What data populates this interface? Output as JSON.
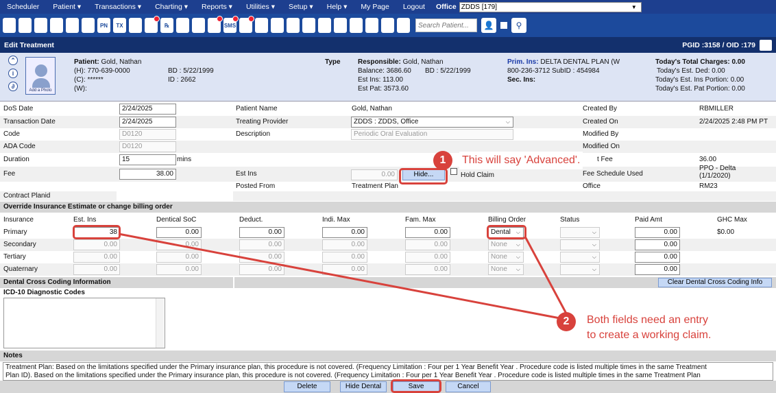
{
  "menu": {
    "items": [
      "Scheduler",
      "Patient ▾",
      "Transactions ▾",
      "Charting ▾",
      "Reports ▾",
      "Utilities ▾",
      "Setup ▾",
      "Help ▾",
      "My Page",
      "Logout"
    ],
    "office_label": "Office",
    "office_value": "ZDDS [179]"
  },
  "toolbar": {
    "icons": [
      "home-icon",
      "calendar-icon",
      "network-icon",
      "pen-icon",
      "tooth-icon",
      "tooth-chart-icon",
      "pn-icon",
      "tx-icon",
      "add-person-icon",
      "globe-icon",
      "rx-icon",
      "message-icon",
      "chat-icon",
      "list-icon",
      "sms-icon",
      "refresh-icon",
      "dollar-icon",
      "org-icon",
      "chart-icon",
      "support-icon",
      "megaphone-icon",
      "print-icon",
      "document-icon",
      "shield-check-icon",
      "shield-plus-icon",
      "chevron-down-badge-icon"
    ],
    "badges": [
      9,
      13,
      14,
      15
    ],
    "labels": {
      "pn": "PN",
      "tx": "TX",
      "rx": "℞",
      "sms": "SMS"
    },
    "search_placeholder": "Search Patient..."
  },
  "title": {
    "left": "Edit Treatment",
    "right": "PGID :3158 / OID :179"
  },
  "patient": {
    "label": "Patient:",
    "name": "Gold, Nathan",
    "home": "(H): 770-639-0000",
    "cell": "(C): ******",
    "work": "(W):",
    "bd": "BD : 5/22/1999",
    "id": "ID : 2662",
    "photo_label": "Add a Photo",
    "type_label": "Type",
    "resp_label": "Responsible:",
    "resp_name": "Gold, Nathan",
    "balance": "Balance: 3686.60",
    "resp_bd": "BD : 5/22/1999",
    "est_ins": "Est Ins: 113.00",
    "est_pat": "Est Pat: 3573.60",
    "prim_label": "Prim. Ins:",
    "prim_value": "DELTA DENTAL PLAN (W",
    "prim_phone": "800-236-3712 SubID : 454984",
    "sec_label": "Sec. Ins:",
    "charges_title": "Today's Total Charges: 0.00",
    "est_ded": "Today's Est. Ded:  0.00",
    "est_ins_portion": "Today's Est. Ins Portion: 0.00",
    "est_pat_portion": "Today's Est. Pat Portion: 0.00"
  },
  "form": {
    "dos_label": "DoS Date",
    "dos_value": "2/24/2025",
    "trans_label": "Transaction Date",
    "trans_value": "2/24/2025",
    "code_label": "Code",
    "code_value": "D0120",
    "ada_label": "ADA Code",
    "ada_value": "D0120",
    "duration_label": "Duration",
    "duration_value": "15",
    "duration_unit": "mins",
    "fee_label": "Fee",
    "fee_value": "38.00",
    "planid_label": "Contract Planid",
    "pname_label": "Patient Name",
    "pname_value": "Gold, Nathan",
    "provider_label": "Treating Provider",
    "provider_value": "ZDDS : ZDDS, Office",
    "desc_label": "Description",
    "desc_value": "Periodic Oral Evaluation",
    "estins_label": "Est Ins",
    "estins_value": "0.00",
    "hide_btn": "Hide...",
    "hold_claim": "Hold Claim",
    "posted_label": "Posted From",
    "posted_value": "Treatment Plan",
    "created_by_label": "Created By",
    "created_by_value": "RBMILLER",
    "created_on_label": "Created On",
    "created_on_value": "2/24/2025 2:48 PM PT",
    "modified_by_label": "Modified By",
    "modified_on_label": "Modified On",
    "fee2_label": "t Fee",
    "fee2_value": "36.00",
    "fee_sched_label": "Fee Schedule Used",
    "fee_sched_value": "PPO - Delta",
    "fee_sched_date": "(1/1/2020)",
    "office_label": "Office",
    "office_value": "RM23"
  },
  "insurance": {
    "section_title": "Override Insurance Estimate or change billing order",
    "headers": [
      "Insurance",
      "Est. Ins",
      "Dentical SoC",
      "Deduct.",
      "Indi. Max",
      "Fam. Max",
      "Billing Order",
      "Status",
      "Paid Amt",
      "GHC Max"
    ],
    "rows": [
      {
        "name": "Primary",
        "est": "38",
        "soc": "0.00",
        "ded": "0.00",
        "indi": "0.00",
        "fam": "0.00",
        "billing": "Dental",
        "paid": "0.00",
        "ghc": "$0.00"
      },
      {
        "name": "Secondary",
        "est": "0.00",
        "soc": "0.00",
        "ded": "0.00",
        "indi": "0.00",
        "fam": "0.00",
        "billing": "None",
        "paid": "0.00",
        "ghc": ""
      },
      {
        "name": "Tertiary",
        "est": "0.00",
        "soc": "0.00",
        "ded": "0.00",
        "indi": "0.00",
        "fam": "0.00",
        "billing": "None",
        "paid": "0.00",
        "ghc": ""
      },
      {
        "name": "Quaternary",
        "est": "0.00",
        "soc": "0.00",
        "ded": "0.00",
        "indi": "0.00",
        "fam": "0.00",
        "billing": "None",
        "paid": "0.00",
        "ghc": ""
      }
    ]
  },
  "cross_coding": {
    "title": "Dental Cross Coding Information",
    "clear_btn": "Clear Dental Cross Coding Info",
    "icd_label": "ICD-10 Diagnostic Codes"
  },
  "notes": {
    "label": "Notes",
    "line1": "Treatment Plan: Based on the limitations specified under the Primary insurance plan, this procedure is not covered. (Frequency Limitation : Four per 1 Year Benefit Year . Procedure code is listed multiple times in the same Treatment",
    "line2": "Plan ID). Based on the limitations specified under the Primary insurance plan, this procedure is not covered. (Frequency Limitation : Four per 1 Year Benefit Year . Procedure code is listed multiple times in the same Treatment Plan"
  },
  "buttons": {
    "delete": "Delete",
    "hide_dental": "Hide Dental",
    "save": "Save",
    "cancel": "Cancel"
  },
  "callouts": {
    "one_num": "1",
    "one_text": "This will say 'Advanced'.",
    "two_num": "2",
    "two_line1": "Both fields need an entry",
    "two_line2": "to create a working claim."
  },
  "colors": {
    "menubar": "#1d3f8f",
    "toolbar": "#1c4a9c",
    "titlebar": "#13306d",
    "callout": "#d8423c",
    "header_bg": "#dde4f4"
  }
}
